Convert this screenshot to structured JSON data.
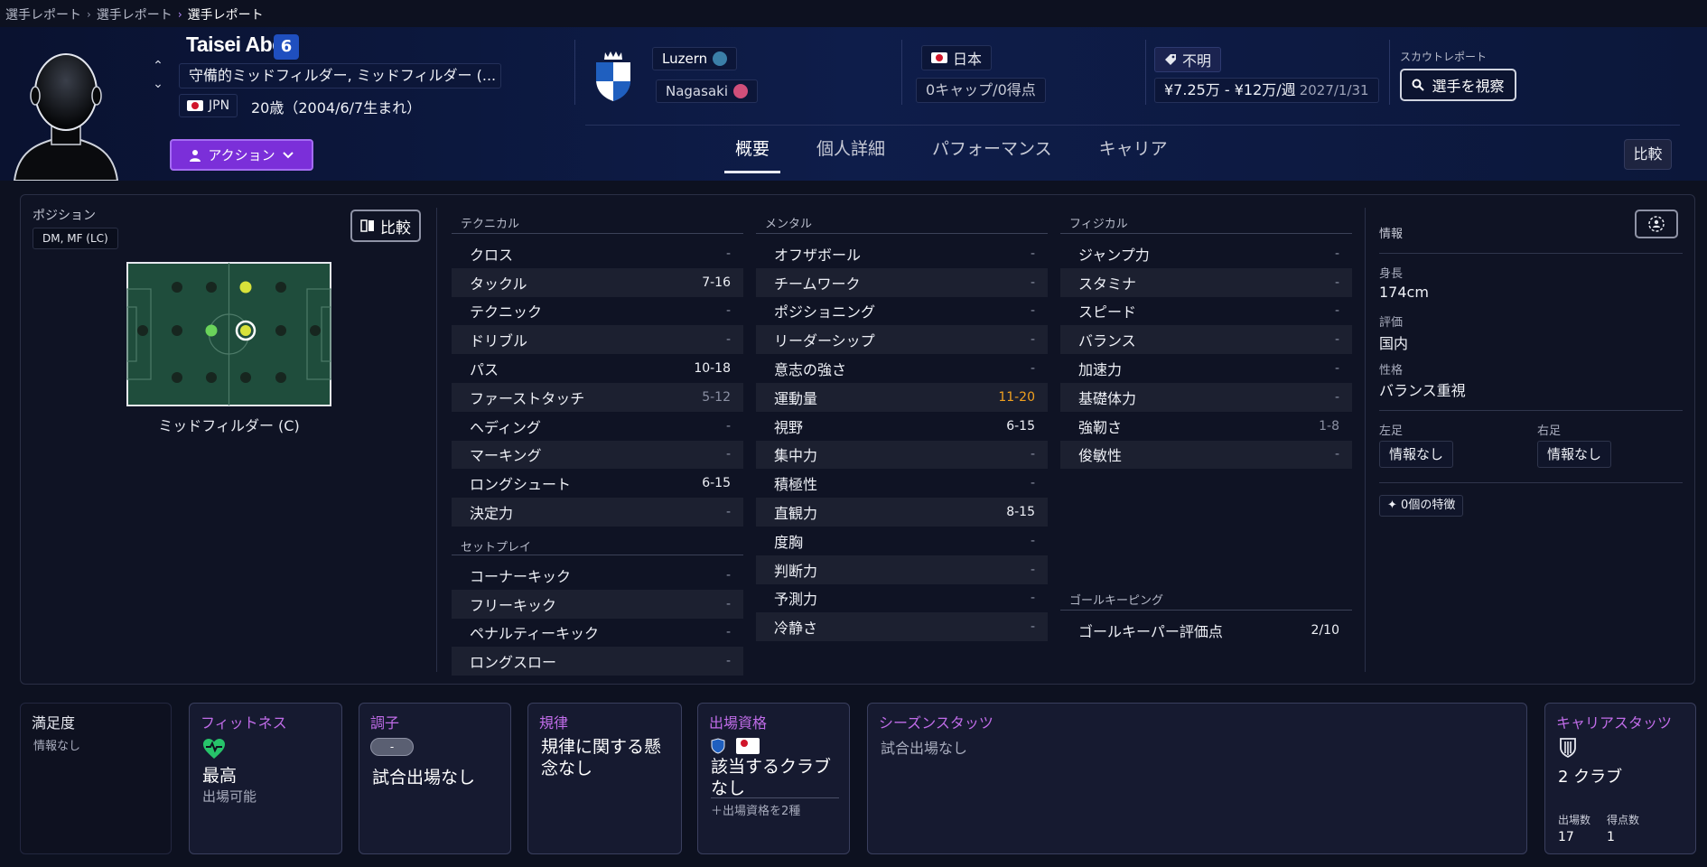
{
  "breadcrumb": [
    "選手レポート",
    "選手レポート",
    "選手レポート"
  ],
  "player": {
    "name": "Taisei Abe",
    "number": "6",
    "positions": "守備的ミッドフィルダー, ミッドフィルダー (...",
    "nationality_code": "JPN",
    "age": "20歳（2004/6/7生まれ）"
  },
  "action_label": "アクション",
  "clubs": {
    "current": "Luzern",
    "loan": "Nagasaki"
  },
  "country": {
    "name": "日本",
    "caps": "0キャップ/0得点"
  },
  "contract": {
    "value": "不明",
    "wage": "¥7.25万 - ¥12万/週",
    "expiry": "2027/1/31"
  },
  "scout": {
    "label": "スカウトレポート",
    "button": "選手を視察"
  },
  "tabs": [
    "概要",
    "個人詳細",
    "パフォーマンス",
    "キャリア"
  ],
  "compare_label": "比較",
  "position_panel": {
    "label": "ポジション",
    "code": "DM, MF (LC)",
    "compare": "比較",
    "caption": "ミッドフィルダー (C)"
  },
  "technical": {
    "title": "テクニカル",
    "rows": [
      {
        "name": "クロス",
        "value": "-"
      },
      {
        "name": "タックル",
        "value": "7-16"
      },
      {
        "name": "テクニック",
        "value": "-"
      },
      {
        "name": "ドリブル",
        "value": "-"
      },
      {
        "name": "パス",
        "value": "10-18"
      },
      {
        "name": "ファーストタッチ",
        "value": "5-12"
      },
      {
        "name": "ヘディング",
        "value": "-"
      },
      {
        "name": "マーキング",
        "value": "-"
      },
      {
        "name": "ロングシュート",
        "value": "6-15"
      },
      {
        "name": "決定力",
        "value": "-"
      }
    ]
  },
  "setpiece": {
    "title": "セットプレイ",
    "rows": [
      {
        "name": "コーナーキック",
        "value": "-"
      },
      {
        "name": "フリーキック",
        "value": "-"
      },
      {
        "name": "ペナルティーキック",
        "value": "-"
      },
      {
        "name": "ロングスロー",
        "value": "-"
      }
    ]
  },
  "mental": {
    "title": "メンタル",
    "rows": [
      {
        "name": "オフザボール",
        "value": "-"
      },
      {
        "name": "チームワーク",
        "value": "-"
      },
      {
        "name": "ポジショニング",
        "value": "-"
      },
      {
        "name": "リーダーシップ",
        "value": "-"
      },
      {
        "name": "意志の強さ",
        "value": "-"
      },
      {
        "name": "運動量",
        "value": "11-20"
      },
      {
        "name": "視野",
        "value": "6-15"
      },
      {
        "name": "集中力",
        "value": "-"
      },
      {
        "name": "積極性",
        "value": "-"
      },
      {
        "name": "直観力",
        "value": "8-15"
      },
      {
        "name": "度胸",
        "value": "-"
      },
      {
        "name": "判断力",
        "value": "-"
      },
      {
        "name": "予測力",
        "value": "-"
      },
      {
        "name": "冷静さ",
        "value": "-"
      }
    ]
  },
  "physical": {
    "title": "フィジカル",
    "rows": [
      {
        "name": "ジャンプ力",
        "value": "-"
      },
      {
        "name": "スタミナ",
        "value": "-"
      },
      {
        "name": "スピード",
        "value": "-"
      },
      {
        "name": "バランス",
        "value": "-"
      },
      {
        "name": "加速力",
        "value": "-"
      },
      {
        "name": "基礎体力",
        "value": "-"
      },
      {
        "name": "強靭さ",
        "value": "1-8"
      },
      {
        "name": "俊敏性",
        "value": "-"
      }
    ]
  },
  "goalkeeping": {
    "title": "ゴールキーピング",
    "rows": [
      {
        "name": "ゴールキーパー評価点",
        "value": "2/10"
      }
    ]
  },
  "info": {
    "title": "情報",
    "height_label": "身長",
    "height": "174cm",
    "rating_label": "評価",
    "rating": "国内",
    "personality_label": "性格",
    "personality": "バランス重視",
    "left_foot_label": "左足",
    "left_foot": "情報なし",
    "right_foot_label": "右足",
    "right_foot": "情報なし",
    "traits": "0個の特徴"
  },
  "cards": {
    "satisfaction": {
      "title": "満足度",
      "value": "情報なし"
    },
    "fitness": {
      "title": "フィットネス",
      "value": "最高",
      "sub": "出場可能"
    },
    "form": {
      "title": "調子",
      "pill": "-",
      "value": "試合出場なし"
    },
    "discipline": {
      "title": "規律",
      "value": "規律に関する懸念なし"
    },
    "eligibility": {
      "title": "出場資格",
      "value": "該当するクラブなし",
      "sub": "＋出場資格を2種"
    },
    "season": {
      "title": "シーズンスタッツ",
      "value": "試合出場なし"
    },
    "career": {
      "title": "キャリアスタッツ",
      "value": "2 クラブ",
      "apps_label": "出場数",
      "apps": "17",
      "goals_label": "得点数",
      "goals": "1"
    }
  },
  "colors": {
    "accent": "#7b2fd9",
    "card_title": "#c06ce8",
    "highlight_value": "#f0a020",
    "pitch": "#1f4d3c"
  }
}
